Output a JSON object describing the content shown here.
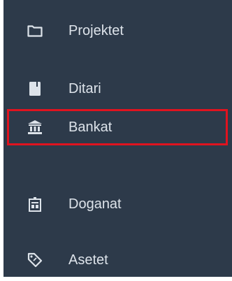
{
  "sidebar": {
    "items": [
      {
        "label": "Projektet",
        "icon": "folder-icon"
      },
      {
        "label": "Ditari",
        "icon": "book-icon"
      },
      {
        "label": "Bankat",
        "icon": "bank-icon"
      },
      {
        "label": "Doganat",
        "icon": "customs-building-icon"
      },
      {
        "label": "Asetet",
        "icon": "tag-icon"
      }
    ],
    "highlighted_item": "Bankat"
  },
  "colors": {
    "sidebar_bg": "#2d3a4a",
    "text": "#dde3ea",
    "highlight_border": "#e0131f"
  }
}
